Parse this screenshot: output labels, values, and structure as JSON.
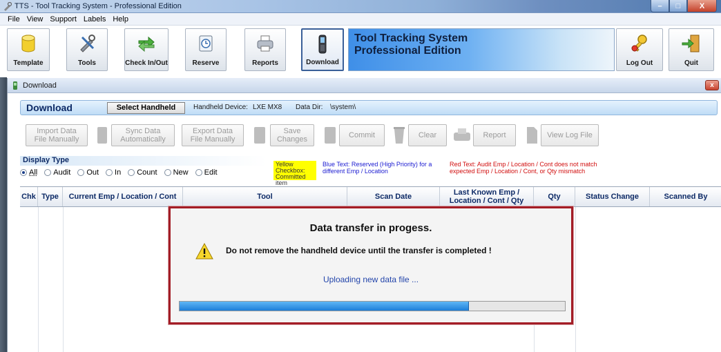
{
  "window": {
    "title": "TTS - Tool Tracking System - Professional Edition",
    "min_label": "–",
    "max_label": "□",
    "close_label": "X"
  },
  "menu": [
    "File",
    "View",
    "Support",
    "Labels",
    "Help"
  ],
  "toolbar": {
    "buttons": [
      {
        "label": "Template",
        "icon": "database-icon"
      },
      {
        "label": "Tools",
        "icon": "tools-icon"
      },
      {
        "label": "Check In/Out",
        "icon": "arrows-icon"
      },
      {
        "label": "Reserve",
        "icon": "clock-icon"
      },
      {
        "label": "Reports",
        "icon": "printer-icon"
      },
      {
        "label": "Download",
        "icon": "handheld-icon"
      }
    ],
    "banner_line1": "Tool Tracking System",
    "banner_line2": "Professional Edition",
    "logout_label": "Log Out",
    "quit_label": "Quit"
  },
  "child_window": {
    "title": "Download",
    "close_label": "x"
  },
  "download_panel": {
    "title": "Download",
    "select_handheld": "Select Handheld",
    "device_label": "Handheld Device:",
    "device_value": "LXE MX8",
    "datadir_label": "Data Dir:",
    "datadir_value": "\\system\\"
  },
  "actions": {
    "import_1": "Import Data",
    "import_2": "File Manually",
    "sync_1": "Sync Data",
    "sync_2": "Automatically",
    "export_1": "Export Data",
    "export_2": "File Manually",
    "save_1": "Save",
    "save_2": "Changes",
    "commit": "Commit",
    "clear": "Clear",
    "report": "Report",
    "viewlog": "View Log File"
  },
  "display_type": {
    "label": "Display Type",
    "options": [
      "All",
      "Audit",
      "Out",
      "In",
      "Count",
      "New",
      "Edit"
    ],
    "selected": "All"
  },
  "legend": {
    "yellow": "Yellow Checkbox: Committed item",
    "blue": "Blue Text: Reserved (High Priority) for a different Emp / Location",
    "red": "Red Text: Audit Emp / Location / Cont does not match expected Emp / Location / Cont, or Qty mismatch"
  },
  "table": {
    "columns": [
      "Chk",
      "Type",
      "Current Emp / Location / Cont",
      "Tool",
      "Scan Date",
      "Last Known Emp / Location / Cont / Qty",
      "Qty",
      "Status Change",
      "Scanned By"
    ]
  },
  "modal": {
    "title": "Data transfer in progess.",
    "message": "Do not remove the handheld device until the transfer is completed !",
    "status": "Uploading new data file ...",
    "progress": 0.75
  }
}
